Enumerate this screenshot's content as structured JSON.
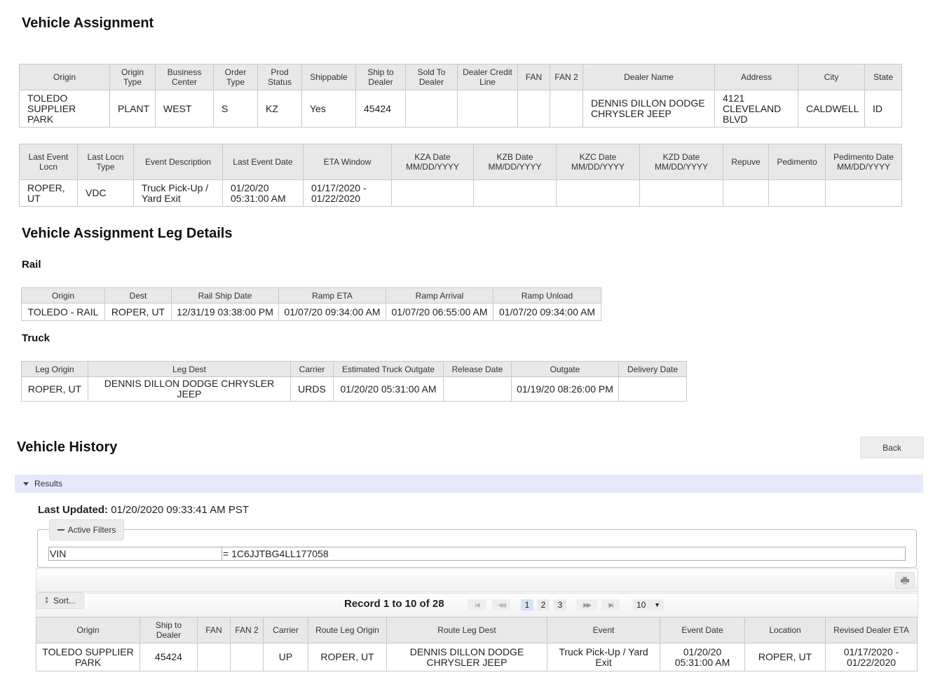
{
  "assignment": {
    "title": "Vehicle Assignment",
    "table1": {
      "headers": [
        "Origin",
        "Origin Type",
        "Business Center",
        "Order Type",
        "Prod Status",
        "Shippable",
        "Ship to Dealer",
        "Sold To Dealer",
        "Dealer Credit Line",
        "FAN",
        "FAN 2",
        "Dealer Name",
        "Address",
        "City",
        "State"
      ],
      "row": [
        "TOLEDO SUPPLIER PARK",
        "PLANT",
        "WEST",
        "S",
        "KZ",
        "Yes",
        "45424",
        "",
        "",
        "",
        "",
        "DENNIS DILLON DODGE CHRYSLER JEEP",
        "4121 CLEVELAND BLVD",
        "CALDWELL",
        "ID"
      ]
    },
    "table2": {
      "headers": [
        "Last Event Locn",
        "Last Locn Type",
        "Event Description",
        "Last Event Date",
        "ETA Window",
        "KZA Date MM/DD/YYYY",
        "KZB Date MM/DD/YYYY",
        "KZC Date MM/DD/YYYY",
        "KZD Date MM/DD/YYYY",
        "Repuve",
        "Pedimento",
        "Pedimento Date MM/DD/YYYY"
      ],
      "row": [
        "ROPER, UT",
        "VDC",
        "Truck Pick-Up / Yard Exit",
        "01/20/20 05:31:00 AM",
        "01/17/2020 - 01/22/2020",
        "",
        "",
        "",
        "",
        "",
        "",
        ""
      ]
    }
  },
  "leg_details": {
    "title": "Vehicle Assignment Leg Details",
    "rail": {
      "title": "Rail",
      "headers": [
        "Origin",
        "Dest",
        "Rail Ship Date",
        "Ramp ETA",
        "Ramp Arrival",
        "Ramp Unload"
      ],
      "row": [
        "TOLEDO - RAIL",
        "ROPER, UT",
        "12/31/19 03:38:00 PM",
        "01/07/20 09:34:00 AM",
        "01/07/20 06:55:00 AM",
        "01/07/20 09:34:00 AM"
      ]
    },
    "truck": {
      "title": "Truck",
      "headers": [
        "Leg Origin",
        "Leg Dest",
        "Carrier",
        "Estimated Truck Outgate",
        "Release Date",
        "Outgate",
        "Delivery Date"
      ],
      "row": [
        "ROPER, UT",
        "DENNIS DILLON DODGE CHRYSLER JEEP",
        "URDS",
        "01/20/20 05:31:00 AM",
        "",
        "01/19/20 08:26:00 PM",
        ""
      ]
    }
  },
  "history": {
    "title": "Vehicle History",
    "back_label": "Back",
    "results_label": "Results",
    "last_updated_label": "Last Updated:",
    "last_updated_value": "01/20/2020 09:33:41 AM PST",
    "active_filters_label": "Active Filters",
    "filter": {
      "key": "VIN",
      "value": "= 1C6JJTBG4LL177058"
    },
    "sort_label": "Sort...",
    "record_text": "Record 1 to 10 of 28",
    "pages": [
      "1",
      "2",
      "3"
    ],
    "active_page": "1",
    "page_size": "10",
    "table": {
      "headers": [
        "Origin",
        "Ship to Dealer",
        "FAN",
        "FAN 2",
        "Carrier",
        "Route Leg Origin",
        "Route Leg Dest",
        "Event",
        "Event Date",
        "Location",
        "Revised Dealer ETA"
      ],
      "row": [
        "TOLEDO SUPPLIER PARK",
        "45424",
        "",
        "",
        "UP",
        "ROPER, UT",
        "DENNIS DILLON DODGE CHRYSLER JEEP",
        "Truck Pick-Up / Yard Exit",
        "01/20/20 05:31:00 AM",
        "ROPER, UT",
        "01/17/2020 - 01/22/2020"
      ]
    }
  },
  "colors": {
    "header_bg": "#e8e8e8",
    "results_bar_bg": "#e6e8fb",
    "border": "#c8c8c8",
    "active_page_bg": "#d8e0fa"
  },
  "icons": {
    "results_toggle": "caret-down-icon",
    "filters_collapse": "minus-icon",
    "print": "print-icon",
    "sort": "sort-arrows-icon",
    "pager_first": "first-page-icon",
    "pager_prev": "prev-page-icon",
    "pager_next": "next-page-icon",
    "pager_last": "last-page-icon",
    "dropdown": "dropdown-arrow-icon"
  }
}
